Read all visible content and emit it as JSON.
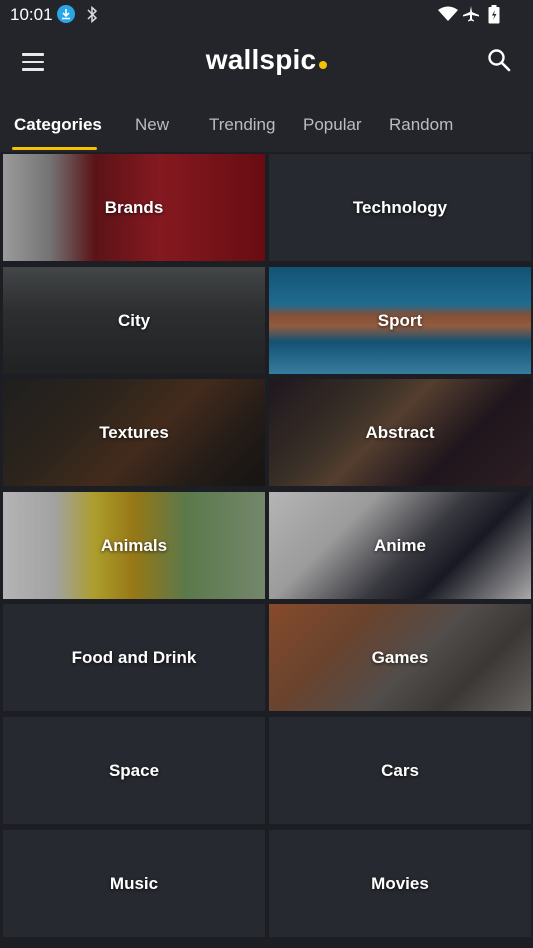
{
  "status_bar": {
    "time": "10:01",
    "icons": [
      "download-icon",
      "bluetooth-icon",
      "wifi-icon",
      "airplane-mode-icon",
      "battery-icon"
    ]
  },
  "app_bar": {
    "logo_text": "wallspic",
    "logo_dot_color": "#f5c100",
    "menu_icon": "hamburger-menu-icon",
    "search_icon": "search-icon"
  },
  "tabs": [
    {
      "label": "Categories",
      "active": true
    },
    {
      "label": "New",
      "active": false
    },
    {
      "label": "Trending",
      "active": false
    },
    {
      "label": "Popular",
      "active": false
    },
    {
      "label": "Random",
      "active": false
    }
  ],
  "categories": [
    {
      "label": "Brands"
    },
    {
      "label": "Technology"
    },
    {
      "label": "City"
    },
    {
      "label": "Sport"
    },
    {
      "label": "Textures"
    },
    {
      "label": "Abstract"
    },
    {
      "label": "Animals"
    },
    {
      "label": "Anime"
    },
    {
      "label": "Food and Drink"
    },
    {
      "label": "Games"
    },
    {
      "label": "Space"
    },
    {
      "label": "Cars"
    },
    {
      "label": "Music"
    },
    {
      "label": "Movies"
    }
  ],
  "colors": {
    "background": "#1c1e23",
    "bar": "#23252b",
    "tile": "#26292f",
    "accent": "#f5c100"
  }
}
